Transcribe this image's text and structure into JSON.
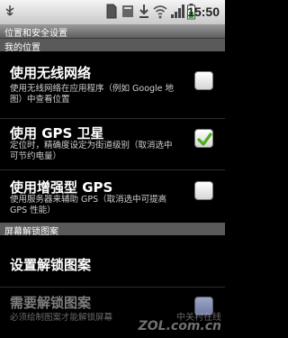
{
  "status_bar": {
    "time": "15:50",
    "icons": [
      "usb-icon",
      "sd-card-icon",
      "notification-icon",
      "download-icon",
      "wifi-icon",
      "signal-icon",
      "battery-icon"
    ]
  },
  "title_bar": {
    "title": "位置和安全设置"
  },
  "sections": {
    "my_location": "我的位置",
    "screen_unlock": "屏幕解锁图案"
  },
  "items": {
    "wireless": {
      "title": "使用无线网络",
      "subtitle": "使用无线网络在应用程序（例如 Google 地图）中查看位置",
      "checked": false
    },
    "gps": {
      "title": "使用 GPS 卫星",
      "subtitle": "定位时，精确度设定为街道级别（取消选中可节约电量）",
      "checked": true
    },
    "agps": {
      "title": "使用增强型 GPS",
      "subtitle": "使用服务器来辅助 GPS（取消选中可提高 GPS 性能）",
      "checked": false
    },
    "set_pattern": {
      "title": "设置解锁图案"
    },
    "require_pattern": {
      "title": "需要解锁图案",
      "subtitle": "必须绘制图案才能解锁屏幕",
      "checked": false,
      "enabled": false
    }
  },
  "watermark": {
    "line1": "中关村在线",
    "line2": "ZOL.com.cn"
  },
  "colors": {
    "check_green": "#4caf1c",
    "section_bg": "#5a5a5a"
  }
}
